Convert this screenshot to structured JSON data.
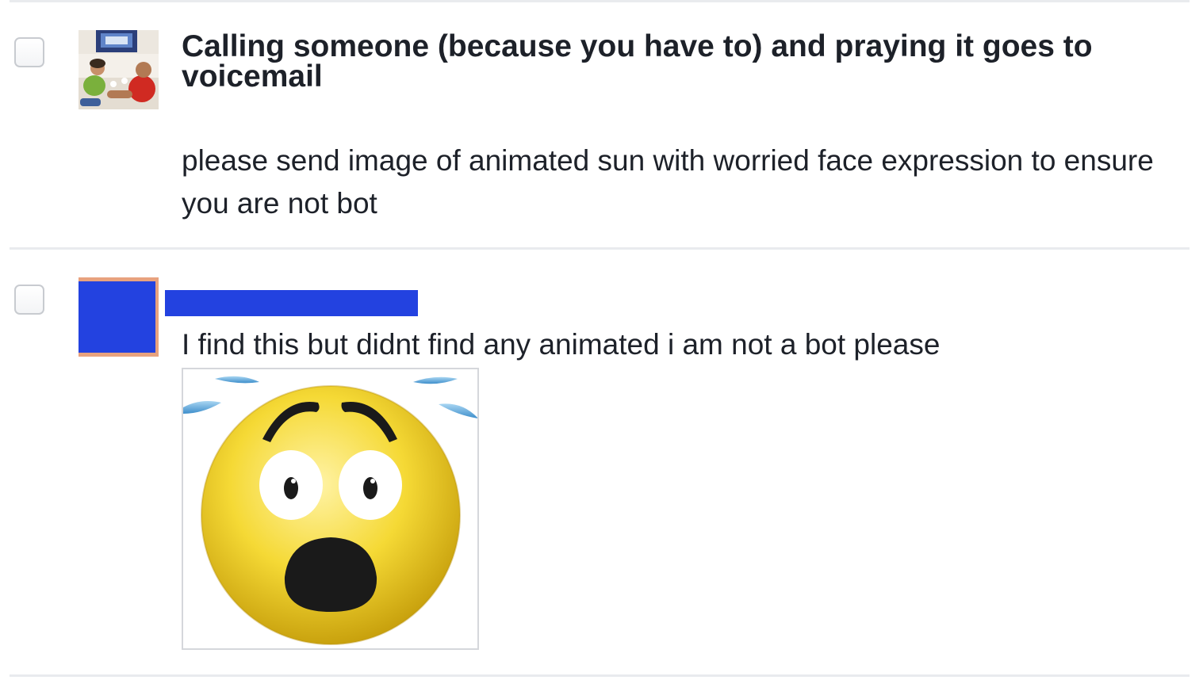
{
  "post": {
    "title": "Calling someone (because you have to) and praying it goes to voicemail",
    "message": "please send image of animated sun with worried face expression to ensure you are not bot",
    "avatar_icon": "two-people-photo-icon"
  },
  "reply": {
    "message": "I find this but didnt find any animated i am not a bot please",
    "avatar_icon": "redacted-avatar",
    "name_redacted": true,
    "attachment_icon": "scared-face-emoji-icon"
  },
  "colors": {
    "redaction": "#2342e0",
    "divider": "#e9ebee",
    "text": "#1d2129"
  }
}
